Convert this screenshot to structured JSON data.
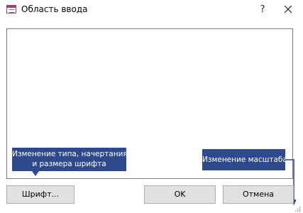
{
  "window": {
    "title": "Область ввода",
    "help_label": "?"
  },
  "buttons": {
    "font_label": "Шрифт...",
    "ok_label": "OK",
    "cancel_label": "Отмена"
  },
  "callouts": {
    "font_line1": "Изменение типа, начертания",
    "font_line2": "и размера шрифта",
    "zoom": "Изменение масштаба"
  },
  "colors": {
    "callout_bg": "#2e4a8c",
    "button_bg": "#e1e1e1",
    "button_border": "#adadad"
  },
  "icons": {
    "app": "form-window-icon",
    "close": "close-icon",
    "help": "help-icon",
    "resize": "resize-grip-icon"
  }
}
